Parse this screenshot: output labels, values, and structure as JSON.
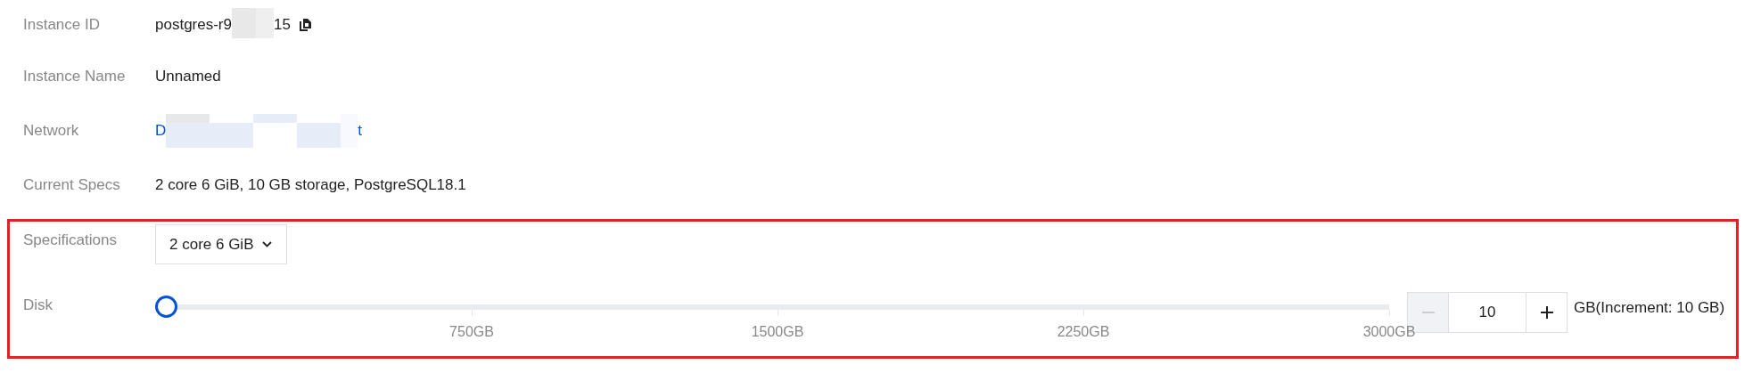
{
  "fields": [
    {
      "label": "Instance ID",
      "kind": "copyable",
      "parts": [
        "postgres-r9",
        "15"
      ]
    },
    {
      "label": "Instance Name",
      "kind": "text",
      "value": "Unnamed"
    },
    {
      "label": "Network",
      "kind": "link",
      "parts": [
        "D",
        "t"
      ]
    },
    {
      "label": "Current Specs",
      "kind": "text",
      "value": "2 core 6 GiB, 10 GB storage, PostgreSQL18.1"
    }
  ],
  "config": {
    "highlighted": true,
    "specifications": {
      "label": "Specifications",
      "value": "2 core 6 GiB"
    },
    "disk": {
      "label": "Disk",
      "level": 0,
      "ticks": [
        "750GB",
        "1500GB",
        "2250GB",
        "3000GB"
      ],
      "stepper": {
        "value": "10",
        "decrease_disabled": true
      },
      "note": "GB(Increment: 10 GB)"
    }
  }
}
